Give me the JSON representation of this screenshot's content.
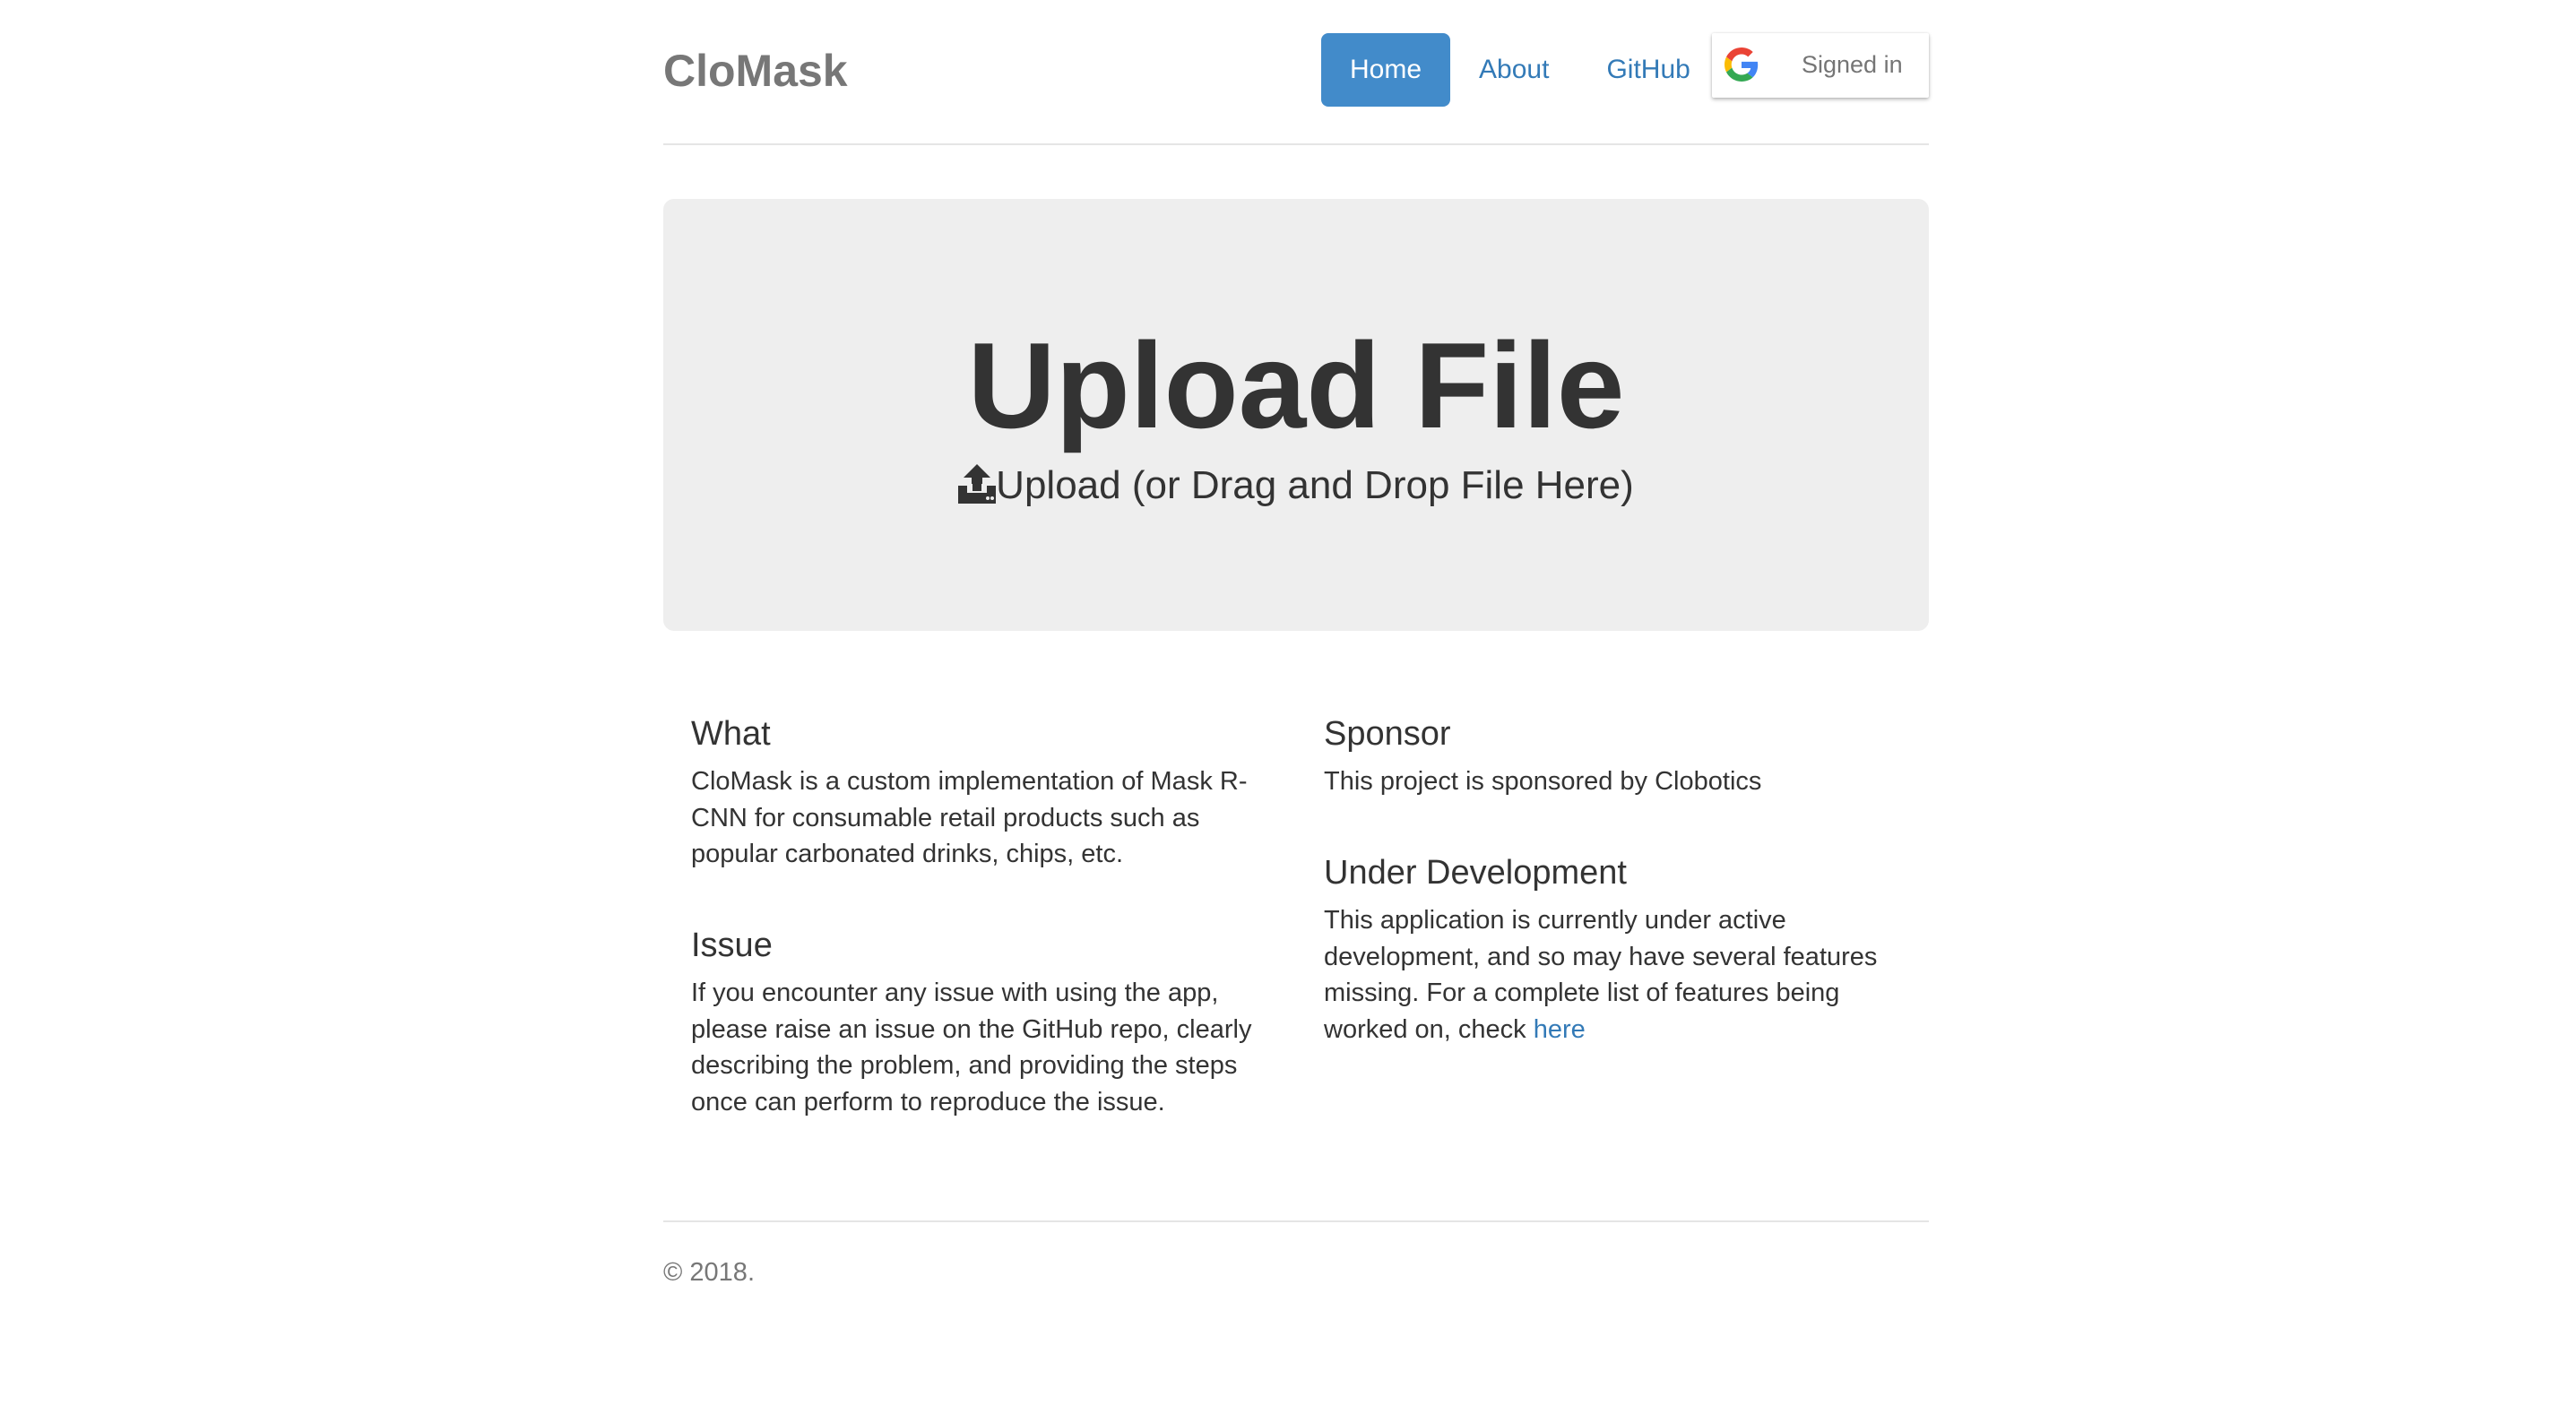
{
  "header": {
    "brand": "CloMask",
    "nav": [
      {
        "label": "Home",
        "active": true
      },
      {
        "label": "About",
        "active": false
      },
      {
        "label": "GitHub",
        "active": false
      }
    ],
    "signin": {
      "label": "Signed in",
      "icon": "google-icon"
    }
  },
  "upload": {
    "title": "Upload File",
    "subtitle": "Upload (or Drag and Drop File Here)",
    "icon": "upload-icon"
  },
  "sections": {
    "what": {
      "title": "What",
      "text": "CloMask is a custom implementation of Mask R-CNN for consumable retail products such as popular carbonated drinks, chips, etc."
    },
    "issue": {
      "title": "Issue",
      "text": "If you encounter any issue with using the app, please raise an issue on the GitHub repo, clearly describing the problem, and providing the steps once can perform to reproduce the issue."
    },
    "sponsor": {
      "title": "Sponsor",
      "text": "This project is sponsored by Clobotics"
    },
    "development": {
      "title": "Under Development",
      "text": "This application is currently under active development, and so may have several features missing. For a complete list of features being worked on, check ",
      "link": "here"
    }
  },
  "footer": {
    "text": "© 2018."
  },
  "colors": {
    "link": "#337ab7",
    "active_nav": "#428bca",
    "jumbotron": "#eeeeee"
  }
}
